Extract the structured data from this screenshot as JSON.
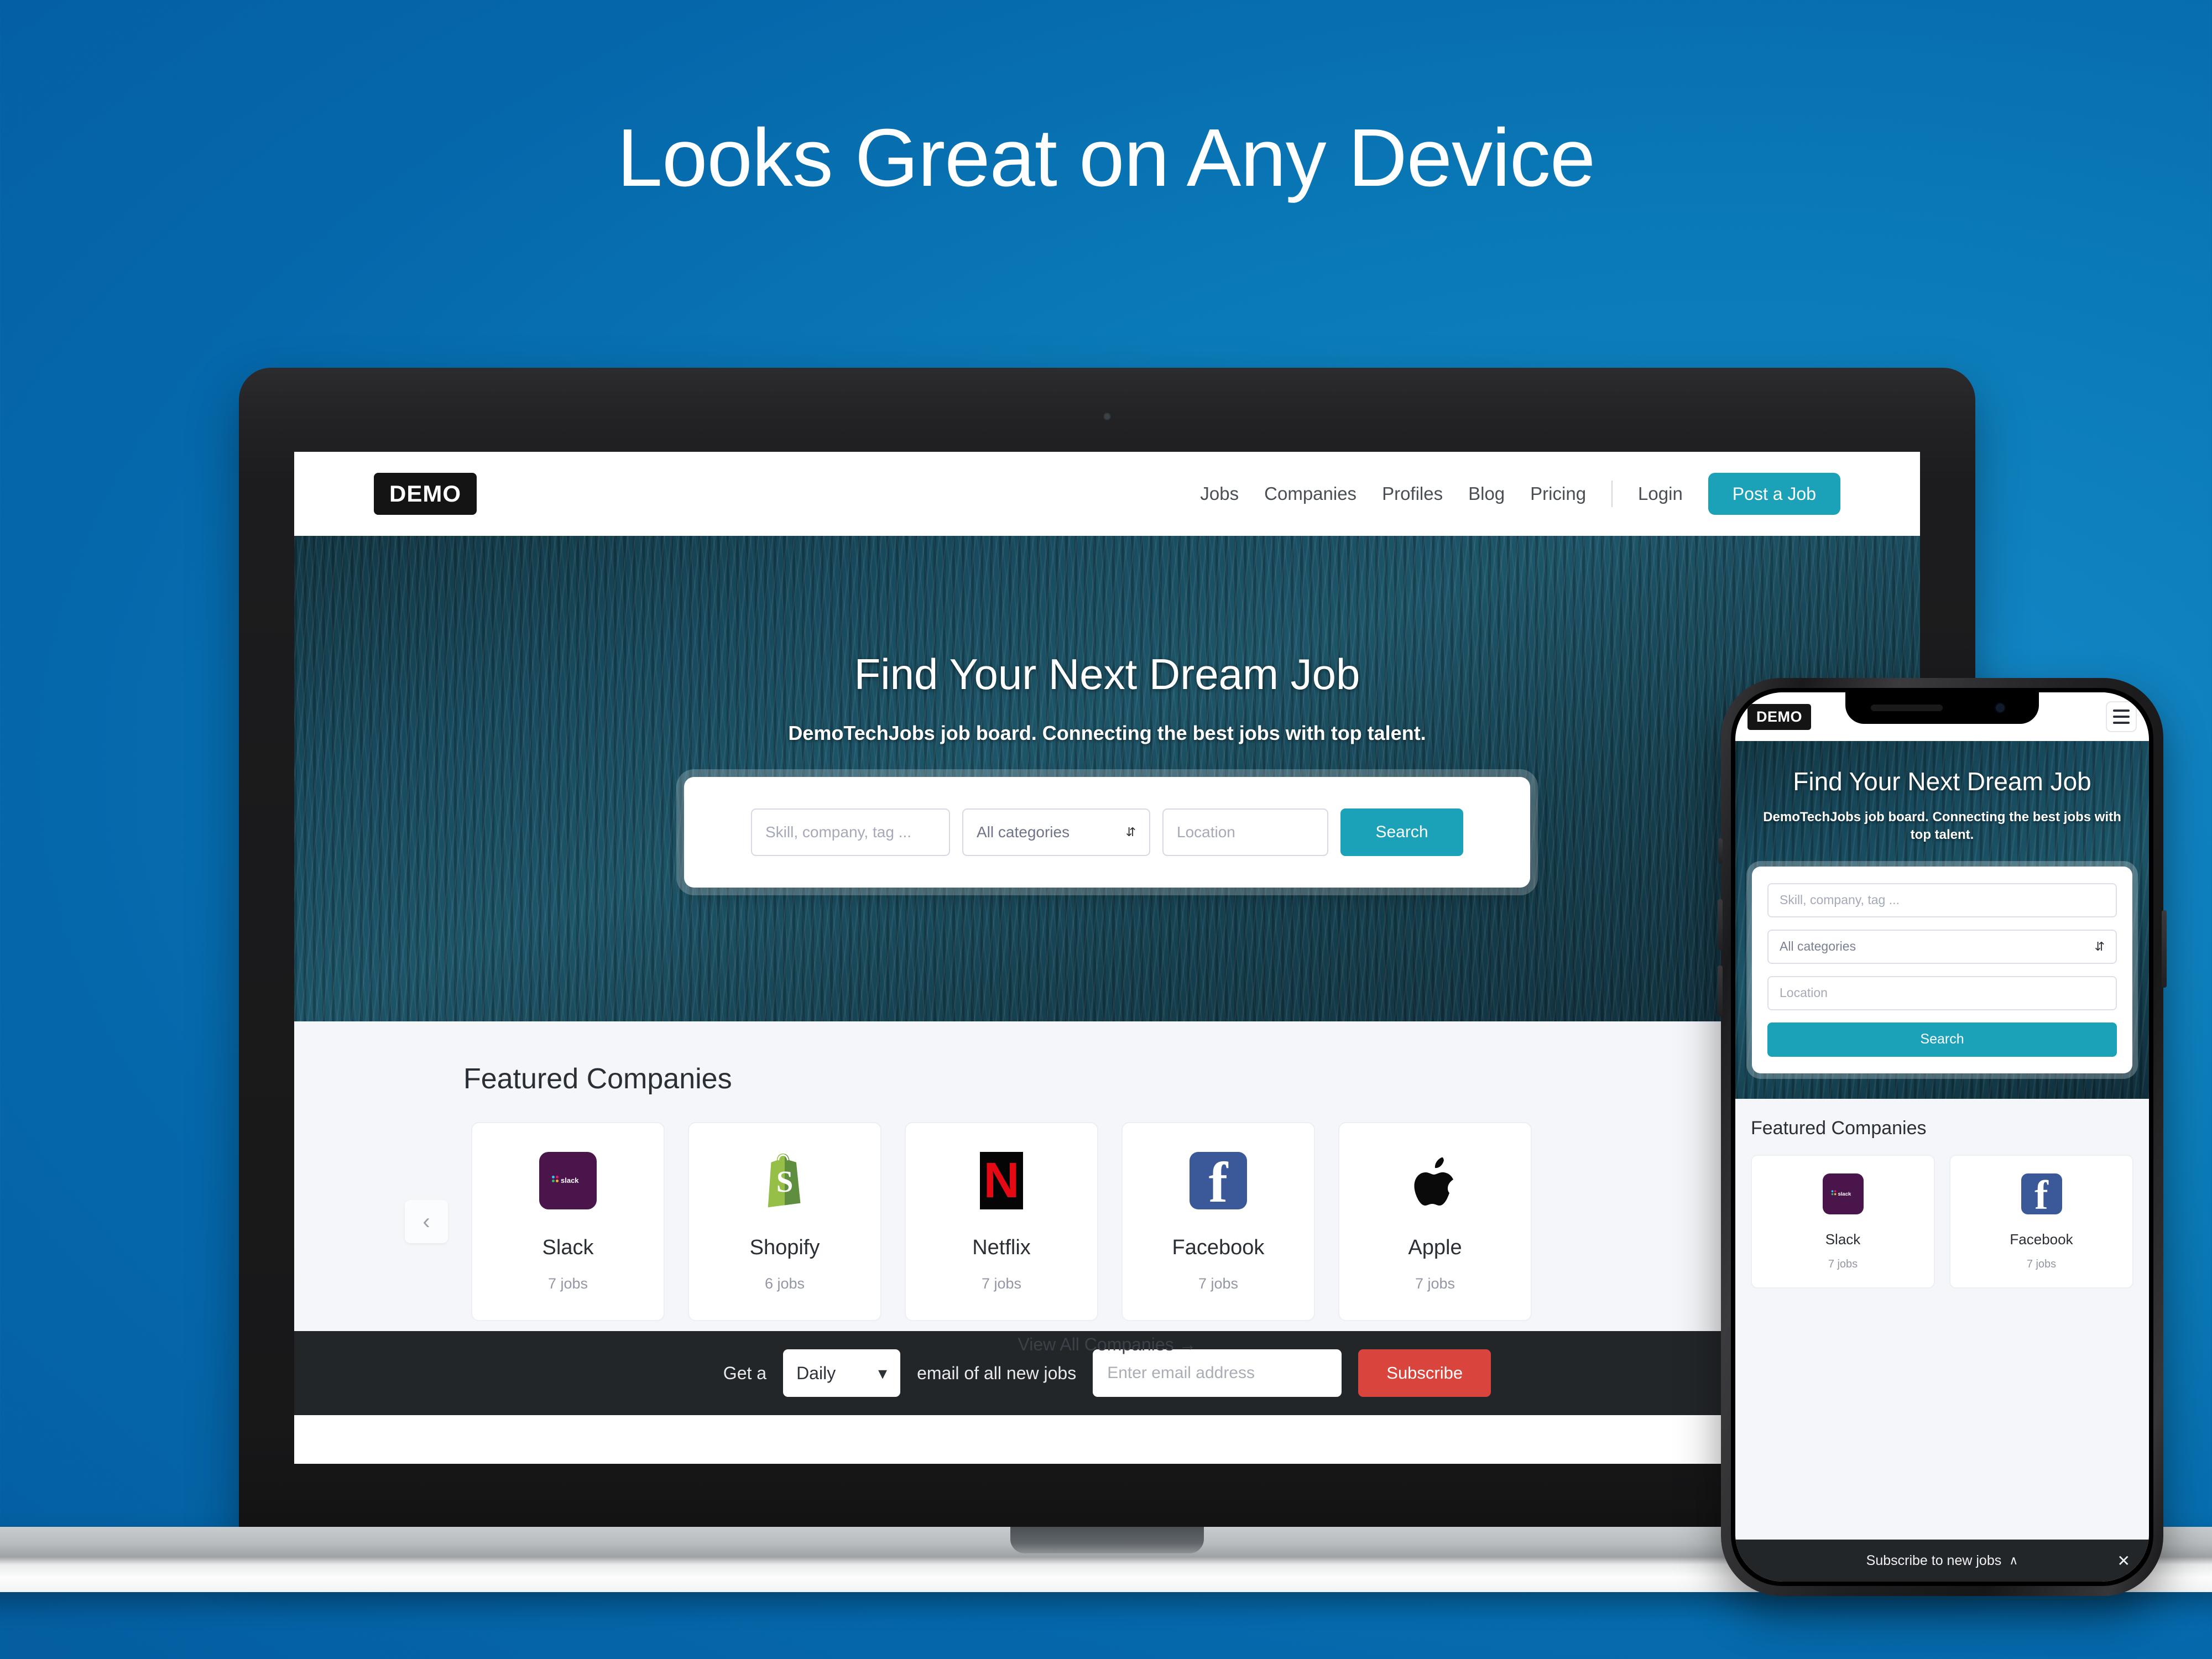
{
  "headline": "Looks Great on Any Device",
  "brand": {
    "logo_text": "DEMO",
    "accent_teal": "#1CA2B8",
    "accent_red": "#D9453C",
    "page_bg": "#0B7BB8"
  },
  "desktop": {
    "nav": {
      "links": [
        {
          "label": "Jobs"
        },
        {
          "label": "Companies"
        },
        {
          "label": "Profiles"
        },
        {
          "label": "Blog"
        },
        {
          "label": "Pricing"
        }
      ],
      "login_label": "Login",
      "cta_label": "Post a Job"
    },
    "hero": {
      "title": "Find Your Next Dream Job",
      "subtitle": "DemoTechJobs job board. Connecting the best jobs with top talent.",
      "search": {
        "keyword_placeholder": "Skill, company, tag ...",
        "category_value": "All categories",
        "location_placeholder": "Location",
        "button_label": "Search"
      }
    },
    "featured": {
      "title": "Featured Companies",
      "prev_arrow": "‹",
      "companies": [
        {
          "name": "Slack",
          "jobs": "7 jobs",
          "logo": "slack-logo"
        },
        {
          "name": "Shopify",
          "jobs": "6 jobs",
          "logo": "shopify-logo"
        },
        {
          "name": "Netflix",
          "jobs": "7 jobs",
          "logo": "netflix-logo"
        },
        {
          "name": "Facebook",
          "jobs": "7 jobs",
          "logo": "facebook-logo"
        },
        {
          "name": "Apple",
          "jobs": "7 jobs",
          "logo": "apple-logo"
        }
      ],
      "view_all_label": "View All Companies →"
    },
    "subscribe_bar": {
      "prefix": "Get a",
      "frequency_value": "Daily",
      "suffix": "email of all new jobs",
      "email_placeholder": "Enter email address",
      "button_label": "Subscribe"
    }
  },
  "phone": {
    "nav": {
      "logo_text": "DEMO",
      "menu_icon": "hamburger-icon"
    },
    "hero": {
      "title": "Find Your Next Dream Job",
      "subtitle": "DemoTechJobs job board. Connecting the best jobs with top talent.",
      "search": {
        "keyword_placeholder": "Skill, company, tag ...",
        "category_value": "All categories",
        "location_placeholder": "Location",
        "button_label": "Search"
      }
    },
    "featured": {
      "title": "Featured Companies",
      "companies": [
        {
          "name": "Slack",
          "jobs": "7 jobs",
          "logo": "slack-logo"
        },
        {
          "name": "Facebook",
          "jobs": "7 jobs",
          "logo": "facebook-logo"
        }
      ]
    },
    "subscribe_bar": {
      "label": "Subscribe to new jobs",
      "chevron": "∧",
      "close": "✕"
    }
  }
}
